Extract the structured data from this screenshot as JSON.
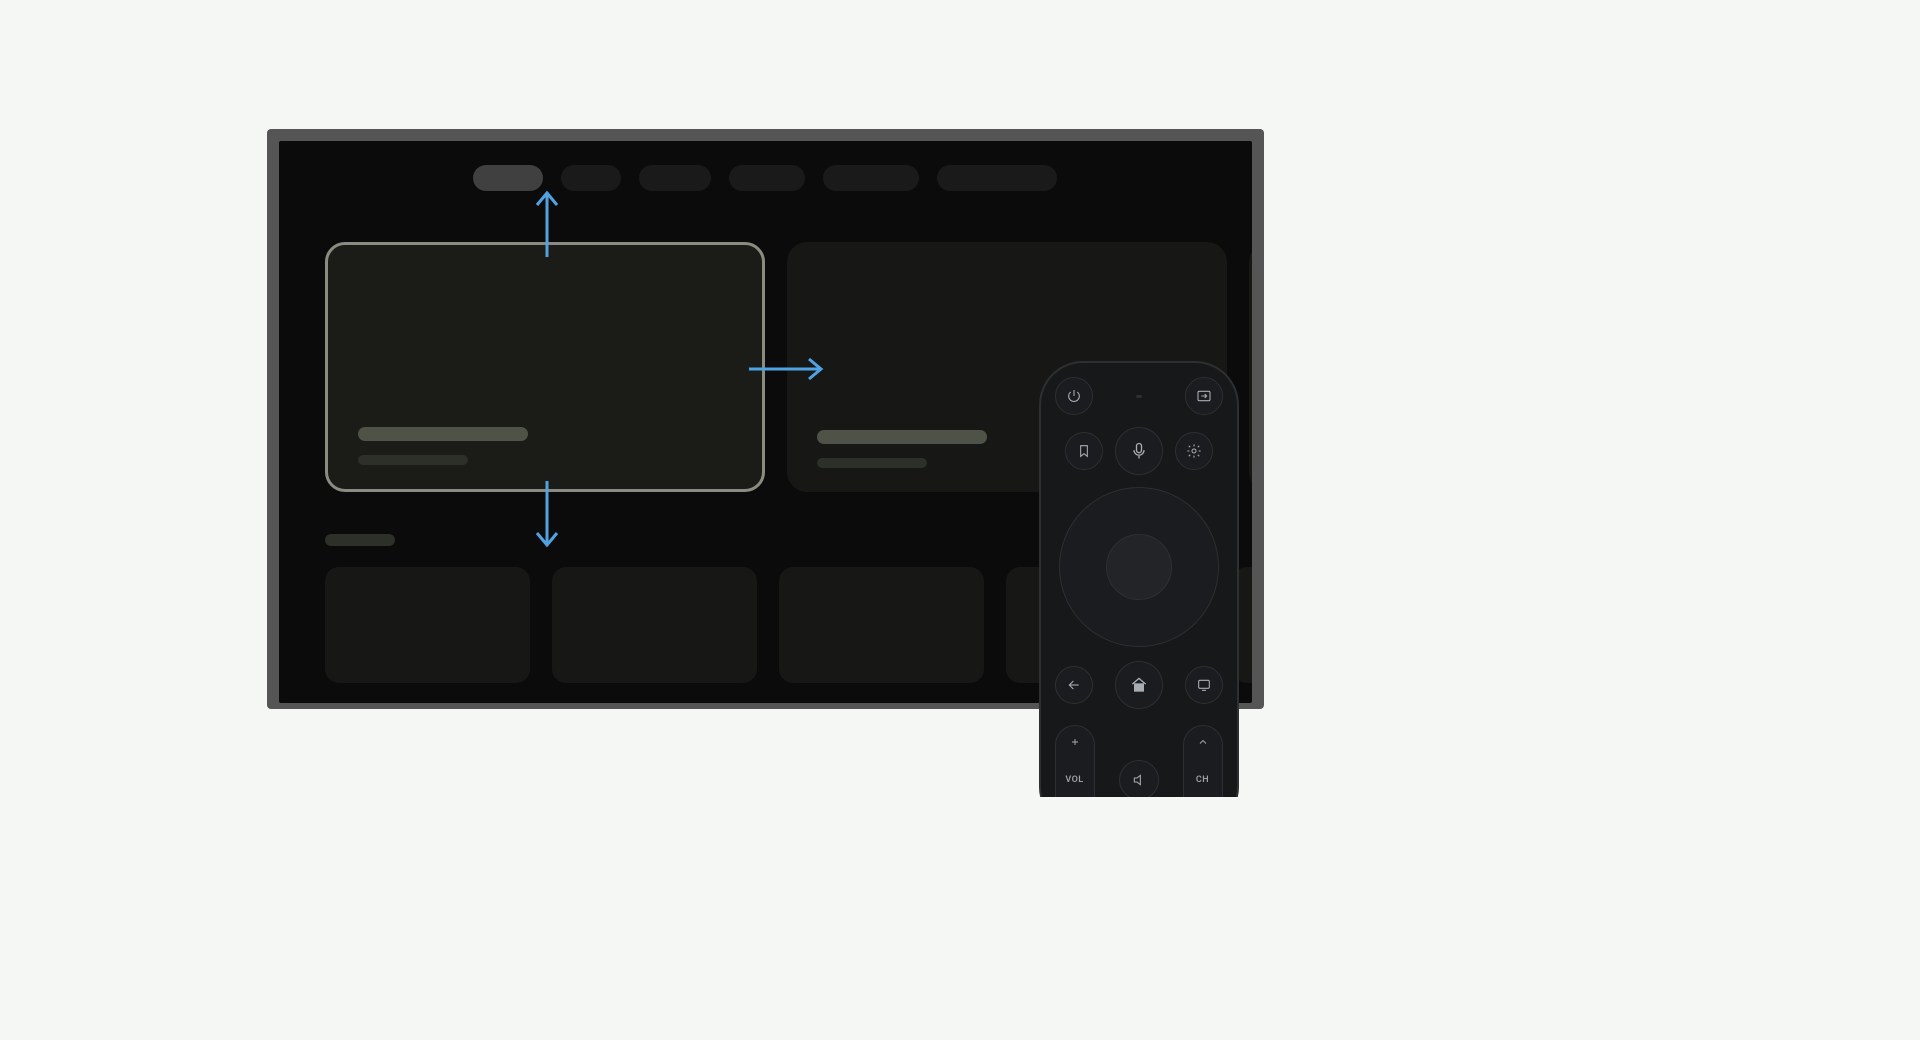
{
  "diagram": {
    "description": "TV interface D-pad navigation illustration showing focused hero card with directional arrows (up to nav tabs, right to next card, down to content row) and a TV remote control",
    "arrow_color": "#4fa3e3",
    "focus_outline_color": "#8a8c82"
  },
  "tv_ui": {
    "nav_tabs_count": 6,
    "nav_active_index": 0,
    "hero_cards_count": 2,
    "hero_focused_index": 0,
    "small_cards_count": 4
  },
  "remote": {
    "vol_label": "VOL",
    "ch_label": "CH",
    "buttons": {
      "power": "power",
      "input": "input-source",
      "bookmark": "bookmark",
      "voice": "voice-mic",
      "settings": "settings-gear",
      "back": "back-arrow",
      "home": "home",
      "guide": "tv-guide",
      "mute": "mute-speaker"
    }
  }
}
